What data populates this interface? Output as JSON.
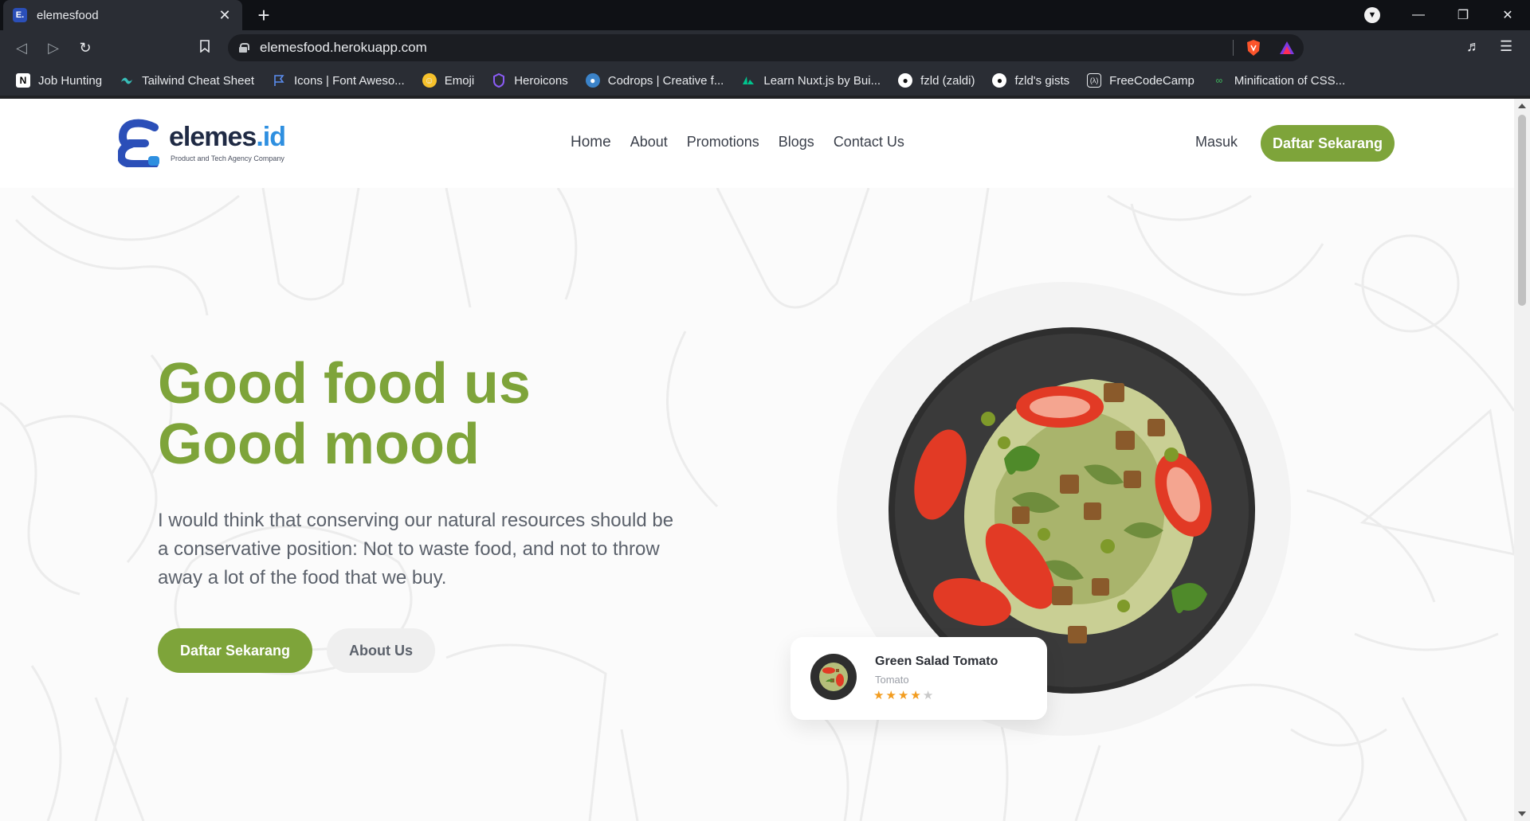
{
  "browser": {
    "tab_title": "elemesfood",
    "tab_favicon": "E.",
    "new_tab_label": "+",
    "url": "elemesfood.herokuapp.com",
    "bookmarks": [
      {
        "label": "Job Hunting",
        "icon": "notion-icon"
      },
      {
        "label": "Tailwind Cheat Sheet",
        "icon": "tailwind-icon"
      },
      {
        "label": "Icons | Font Aweso...",
        "icon": "flag-icon"
      },
      {
        "label": "Emoji",
        "icon": "emoji-icon"
      },
      {
        "label": "Heroicons",
        "icon": "heroicons-icon"
      },
      {
        "label": "Codrops | Creative f...",
        "icon": "codrops-icon"
      },
      {
        "label": "Learn Nuxt.js by Bui...",
        "icon": "nuxt-icon"
      },
      {
        "label": "fzld (zaldi)",
        "icon": "github-icon"
      },
      {
        "label": "fzld's gists",
        "icon": "github-icon"
      },
      {
        "label": "FreeCodeCamp",
        "icon": "freecodecamp-icon"
      },
      {
        "label": "Minification of CSS...",
        "icon": "link-icon"
      }
    ]
  },
  "site": {
    "logo": {
      "word_main": "elemes",
      "word_suffix": ".id",
      "tagline": "Product and Tech Agency Company"
    },
    "nav": [
      {
        "label": "Home"
      },
      {
        "label": "About"
      },
      {
        "label": "Promotions"
      },
      {
        "label": "Blogs"
      },
      {
        "label": "Contact Us"
      }
    ],
    "login_label": "Masuk",
    "register_label": "Daftar Sekarang",
    "hero": {
      "headline_line1": "Good food us",
      "headline_line2": "Good mood",
      "subtext": "I would think that conserving our natural resources should be a conservative position: Not to waste food, and not to throw away a lot of the food that we buy.",
      "primary_cta": "Daftar Sekarang",
      "secondary_cta": "About Us"
    },
    "food_card": {
      "title": "Green Salad Tomato",
      "subtitle": "Tomato",
      "rating": 4,
      "rating_max": 5
    }
  },
  "colors": {
    "brand_green": "#7ea43a",
    "brand_blue": "#2b4fb8",
    "star_filled": "#f29c1f",
    "star_empty": "#c9c9c9"
  }
}
